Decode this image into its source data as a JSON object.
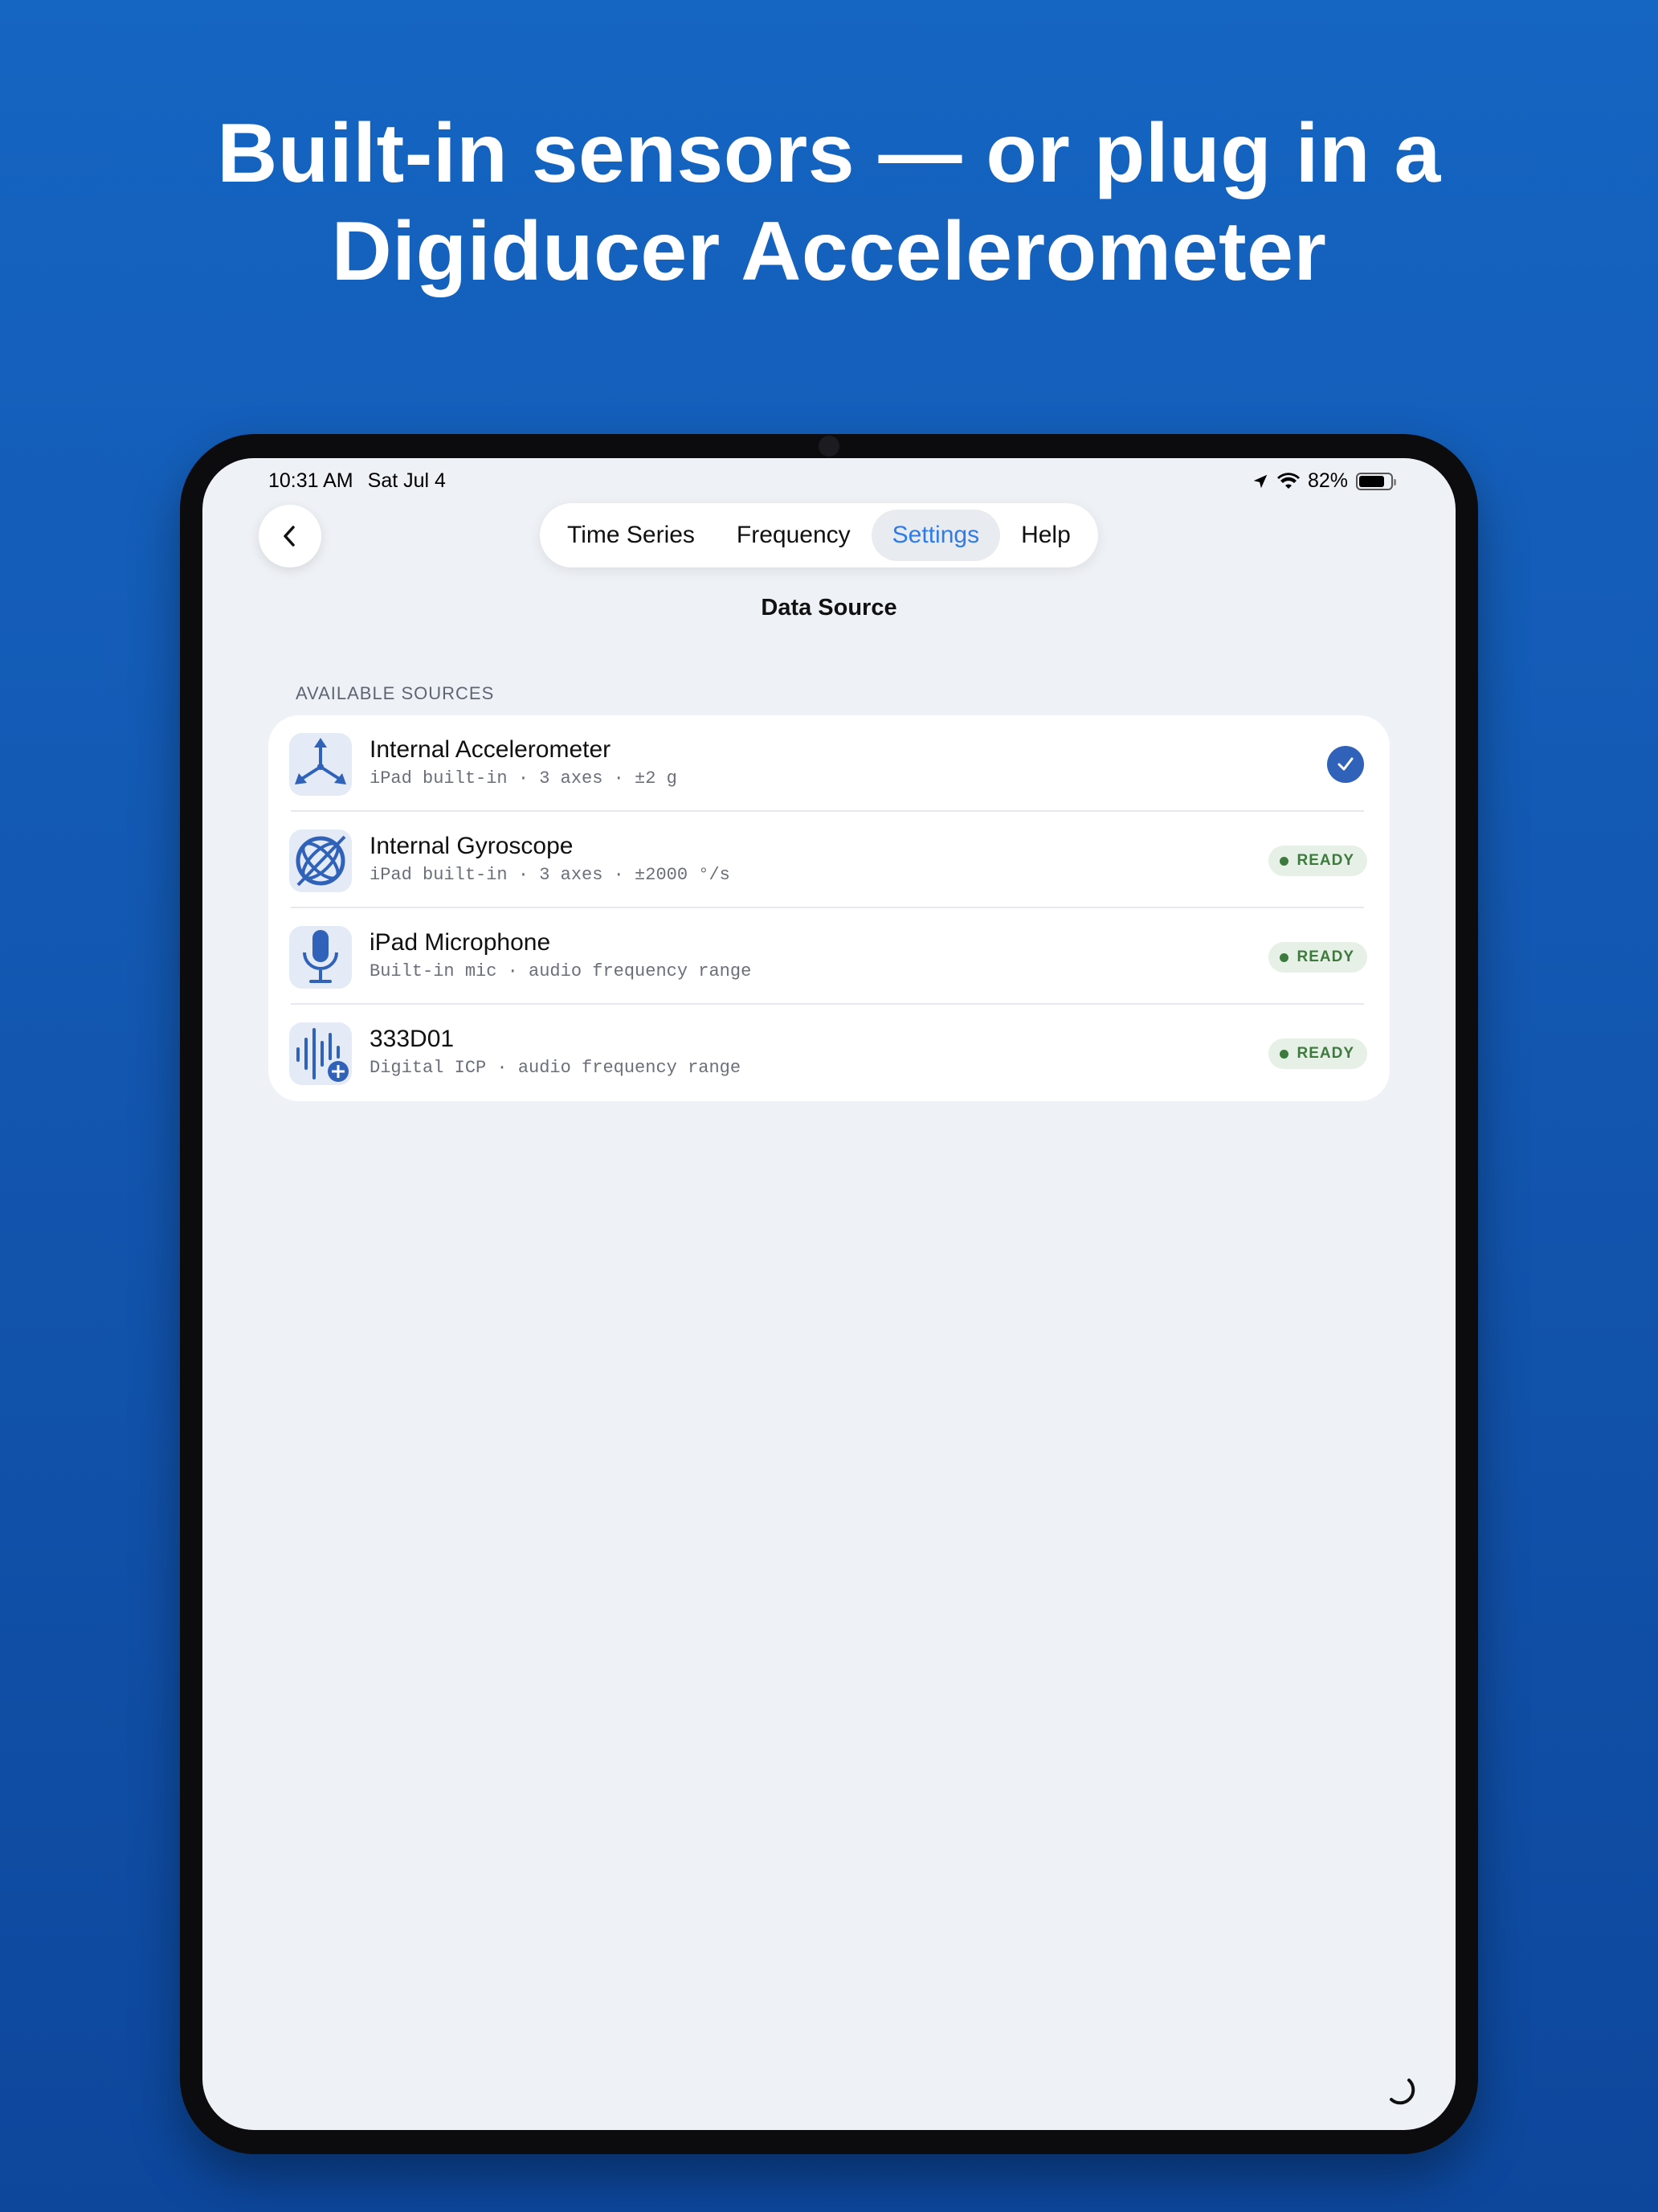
{
  "headline": {
    "line1": "Built-in sensors — or plug in a",
    "line2": "Digiducer Accelerometer"
  },
  "status_bar": {
    "time": "10:31 AM",
    "date": "Sat Jul 4",
    "battery": "82%",
    "battery_level": 0.82
  },
  "nav": {
    "back_icon": "chevron-left-icon",
    "tabs": [
      {
        "label": "Time Series",
        "active": false
      },
      {
        "label": "Frequency",
        "active": false
      },
      {
        "label": "Settings",
        "active": true
      },
      {
        "label": "Help",
        "active": false
      }
    ]
  },
  "page": {
    "title": "Data Source",
    "section_label": "AVAILABLE SOURCES"
  },
  "sources": [
    {
      "title": "Internal Accelerometer",
      "subtitle": "iPad built-in · 3 axes · ±2 g",
      "icon": "accelerometer-icon",
      "state": "selected"
    },
    {
      "title": "Internal Gyroscope",
      "subtitle": "iPad built-in · 3 axes · ±2000 °/s",
      "icon": "gyroscope-icon",
      "state": "READY"
    },
    {
      "title": "iPad Microphone",
      "subtitle": "Built-in mic · audio frequency range",
      "icon": "microphone-icon",
      "state": "READY"
    },
    {
      "title": "333D01",
      "subtitle": "Digital ICP · audio frequency range",
      "icon": "digiducer-waveform-icon",
      "state": "READY"
    }
  ],
  "colors": {
    "accent": "#2f7be8",
    "icon_blue": "#2f62b8",
    "ready_green": "#3d7a3d",
    "background_top": "#1565c2"
  }
}
